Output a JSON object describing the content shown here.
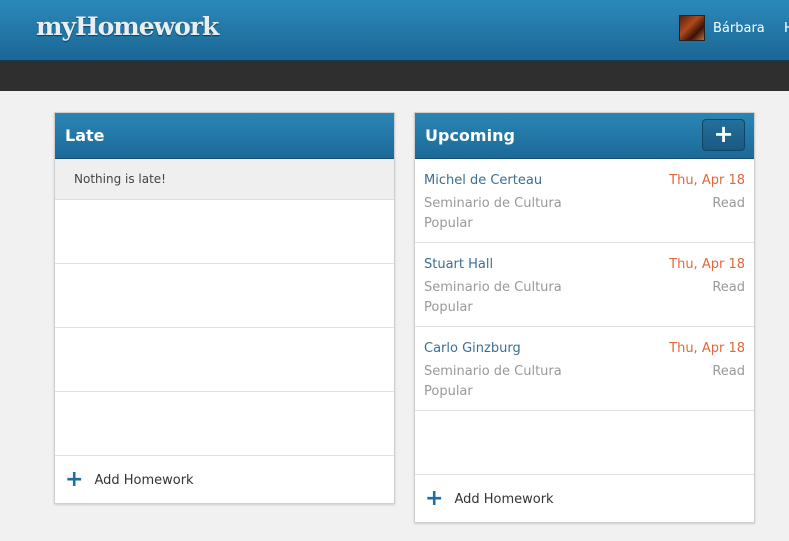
{
  "header": {
    "logo": "myHomework",
    "user_name": "Bárbara",
    "next_nav_partial": "H"
  },
  "late": {
    "title": "Late",
    "empty_message": "Nothing is late!",
    "add_label": "Add Homework"
  },
  "upcoming": {
    "title": "Upcoming",
    "add_button": "+",
    "add_label": "Add Homework",
    "items": [
      {
        "title": "Michel de Certeau",
        "course": "Seminario de Cultura Popular",
        "due": "Thu, Apr 18",
        "type": "Read"
      },
      {
        "title": "Stuart Hall",
        "course": "Seminario de Cultura Popular",
        "due": "Thu, Apr 18",
        "type": "Read"
      },
      {
        "title": "Carlo Ginzburg",
        "course": "Seminario de Cultura Popular",
        "due": "Thu, Apr 18",
        "type": "Read"
      }
    ]
  },
  "colors": {
    "header_blue": "#1f73a3",
    "due_orange": "#e0683b",
    "title_blue": "#3b6e94"
  }
}
